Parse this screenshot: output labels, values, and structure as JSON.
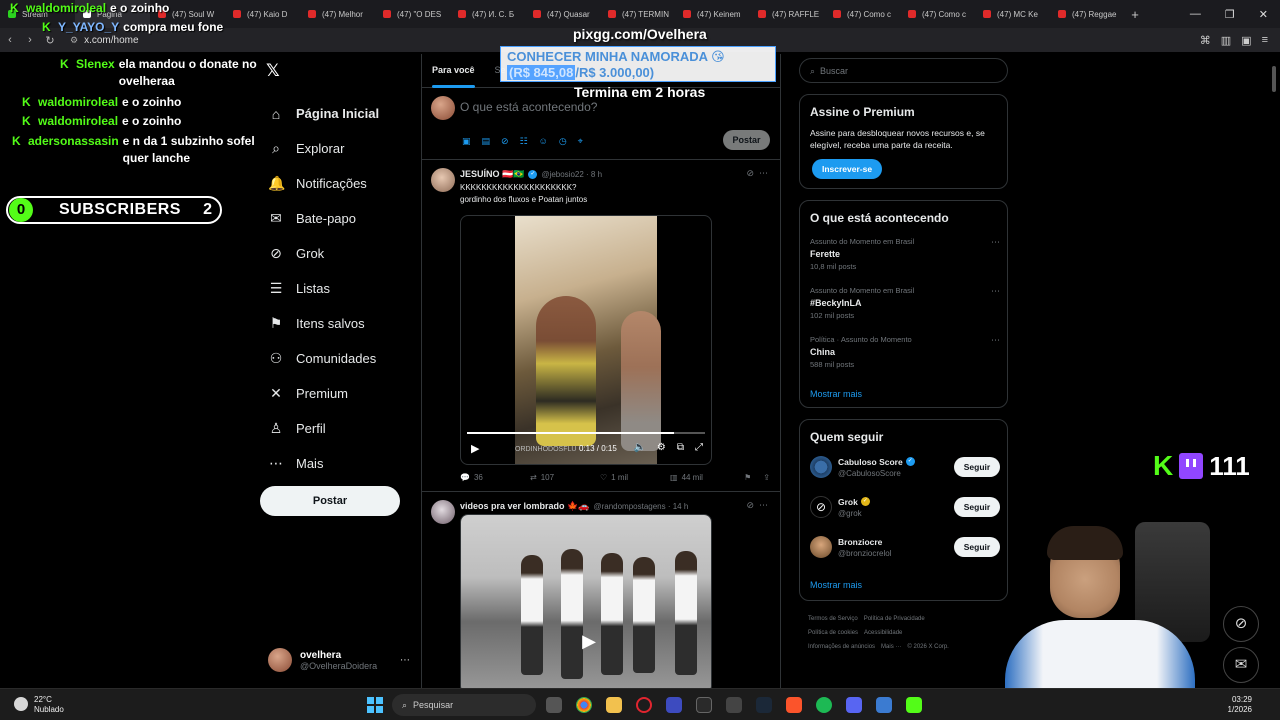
{
  "browser": {
    "tabs": [
      {
        "label": "Stream",
        "icon": "green"
      },
      {
        "label": "Página",
        "icon": "x"
      },
      {
        "label": "(47) Soul W",
        "icon": "youtube"
      },
      {
        "label": "(47) Kaio D",
        "icon": "youtube"
      },
      {
        "label": "(47) Melhor",
        "icon": "youtube"
      },
      {
        "label": "(47) \"O DES",
        "icon": "youtube"
      },
      {
        "label": "(47) И. С. Б",
        "icon": "youtube"
      },
      {
        "label": "(47) Quasar",
        "icon": "youtube"
      },
      {
        "label": "(47) TERMIN",
        "icon": "youtube"
      },
      {
        "label": "(47) Keinem",
        "icon": "youtube"
      },
      {
        "label": "(47) RAFFLE",
        "icon": "youtube"
      },
      {
        "label": "(47) Como c",
        "icon": "youtube"
      },
      {
        "label": "(47) Como c",
        "icon": "youtube"
      },
      {
        "label": "(47) MC Ke",
        "icon": "youtube"
      },
      {
        "label": "(47) Reggae",
        "icon": "youtube"
      }
    ],
    "url": "x.com/home"
  },
  "stream": {
    "chat": [
      {
        "user": "waldomiroleal",
        "msg": "e o zoinho",
        "color": "green"
      },
      {
        "user": "Y_YAYO_Y",
        "msg": "compra meu fone",
        "color": "blue"
      },
      {
        "user": "Slenex",
        "msg": "ela mandou o donate no ovelheraa",
        "color": "green"
      },
      {
        "user": "waldomiroleal",
        "msg": "e o zoinho",
        "color": "green"
      },
      {
        "user": "waldomiroleal",
        "msg": "e o zoinho",
        "color": "green"
      },
      {
        "user": "adersonassasin",
        "msg": "e n da 1 subzinho sofel quer lanche",
        "color": "green"
      }
    ],
    "subs_left": "0",
    "subs_label": "SUBSCRIBERS",
    "subs_right": "2",
    "pix_url": "pixgg.com/Ovelhera",
    "goal_title": "CONHECER MINHA NAMORADA 😘",
    "goal_raised": "(R$ 845,08",
    "goal_target": "/R$ 3.000,00)",
    "goal_ends": "Termina em 2 horas",
    "viewers": "111"
  },
  "x": {
    "nav": [
      {
        "label": "Página Inicial",
        "icon": "home-icon",
        "glyph": "⌂",
        "bold": true
      },
      {
        "label": "Explorar",
        "icon": "search-icon",
        "glyph": "⌕",
        "bold": false
      },
      {
        "label": "Notificações",
        "icon": "bell-icon",
        "glyph": "🔔",
        "bold": false
      },
      {
        "label": "Bate-papo",
        "icon": "mail-icon",
        "glyph": "✉",
        "bold": false
      },
      {
        "label": "Grok",
        "icon": "grok-icon",
        "glyph": "⊘",
        "bold": false
      },
      {
        "label": "Listas",
        "icon": "list-icon",
        "glyph": "☰",
        "bold": false
      },
      {
        "label": "Itens salvos",
        "icon": "bookmark-icon",
        "glyph": "⚑",
        "bold": false
      },
      {
        "label": "Comunidades",
        "icon": "communities-icon",
        "glyph": "⚇",
        "bold": false
      },
      {
        "label": "Premium",
        "icon": "x-premium-icon",
        "glyph": "✕",
        "bold": false
      },
      {
        "label": "Perfil",
        "icon": "profile-icon",
        "glyph": "♙",
        "bold": false
      },
      {
        "label": "Mais",
        "icon": "more-icon",
        "glyph": "⋯",
        "bold": false
      }
    ],
    "post_button": "Postar",
    "account": {
      "name": "ovelhera",
      "handle": "@OvelheraDoidera"
    },
    "tabs": [
      "Para você",
      "Se"
    ],
    "composer_placeholder": "O que está acontecendo?",
    "composer_post": "Postar",
    "tweets": [
      {
        "name": "JESUÍNO 🇦🇹🇧🇷",
        "handle": "@jebosio22 · 8 h",
        "line1": "KKKKKKKKKKKKKKKKKKKKK?",
        "line2": "gordinho dos fluxos e Poatan juntos",
        "video_time": "0:13 / 0:15",
        "watermark": "ORDINHODOSFLU",
        "stats": {
          "replies": "36",
          "reposts": "107",
          "likes": "1 mil",
          "views": "44 mil"
        }
      },
      {
        "name": "videos pra ver lombrado 🍁🚗",
        "handle": "@randompostagens · 14 h"
      }
    ],
    "search_placeholder": "Buscar",
    "premium": {
      "title": "Assine o Premium",
      "text": "Assine para desbloquear novos recursos e, se elegível, receba uma parte da receita.",
      "button": "Inscrever-se"
    },
    "trends_title": "O que está acontecendo",
    "trends": [
      {
        "context": "Assunto do Momento em Brasil",
        "name": "Ferette",
        "count": "10,8 mil posts"
      },
      {
        "context": "Assunto do Momento em Brasil",
        "name": "#BeckyInLA",
        "count": "102 mil posts"
      },
      {
        "context": "Política · Assunto do Momento",
        "name": "China",
        "count": "588 mil posts"
      }
    ],
    "show_more": "Mostrar mais",
    "who_title": "Quem seguir",
    "who": [
      {
        "name": "Cabuloso Score",
        "handle": "@CabulosoScore",
        "button": "Seguir"
      },
      {
        "name": "Grok",
        "handle": "@grok",
        "button": "Seguir"
      },
      {
        "name": "Bronziocre",
        "handle": "@bronziocrelol",
        "button": "Seguir"
      }
    ],
    "footer": [
      "Termos de Serviço",
      "Política de Privacidade",
      "Política de cookies",
      "Acessibilidade",
      "Informações de anúncios",
      "Mais ···",
      "© 2026 X Corp."
    ]
  },
  "taskbar": {
    "temp": "22°C",
    "weather": "Nublado",
    "search": "Pesquisar",
    "time": "03:29",
    "date": "1/2026"
  }
}
